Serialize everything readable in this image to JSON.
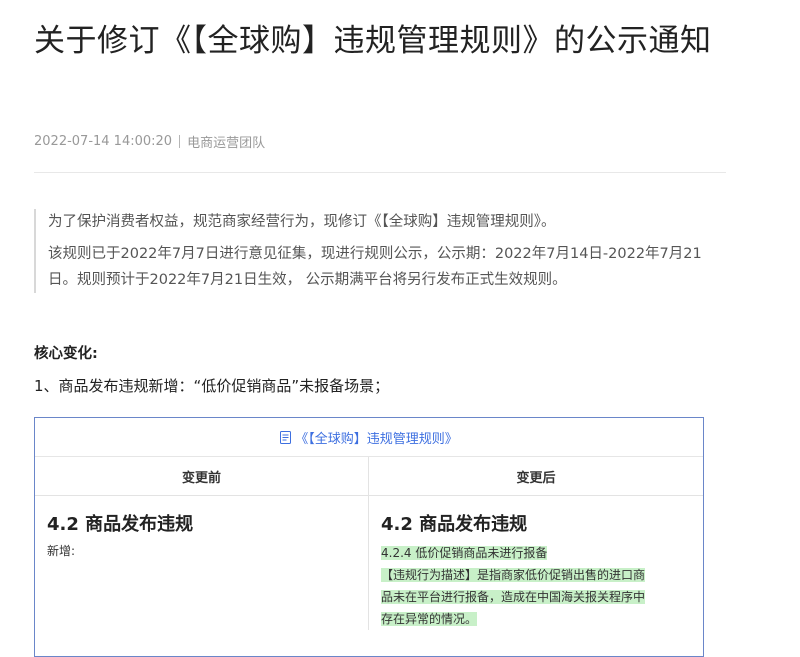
{
  "article": {
    "title": "关于修订《【全球购】违规管理规则》的公示通知",
    "date": "2022-07-14 14:00:20",
    "author": "电商运营团队"
  },
  "intro": {
    "p1": "为了保护消费者权益，规范商家经营行为，现修订《【全球购】违规管理规则》。",
    "p2": "该规则已于2022年7月7日进行意见征集，现进行规则公示，公示期：2022年7月14日-2022年7月21日。规则预计于2022年7月21日生效， 公示期满平台将另行发布正式生效规则。"
  },
  "changes": {
    "heading": "核心变化:",
    "item1": "1、商品发布违规新增：“低价促销商品”未报备场景；"
  },
  "doc_card": {
    "link_icon": "document-icon",
    "link_text": "《【全球购】违规管理规则》",
    "accent": "#3d6fe0",
    "highlight": "#c8f0c8",
    "before": {
      "header": "变更前",
      "section": "4.2 商品发布违规",
      "text": "新增:"
    },
    "after": {
      "header": "变更后",
      "section": "4.2 商品发布违规",
      "lines": [
        "4.2.4 低价促销商品未进行报备",
        "【违规行为描述】是指商家低价促销出售的进口商",
        "品未在平台进行报备，造成在中国海关报关程序中",
        "存在异常的情况。"
      ]
    }
  }
}
